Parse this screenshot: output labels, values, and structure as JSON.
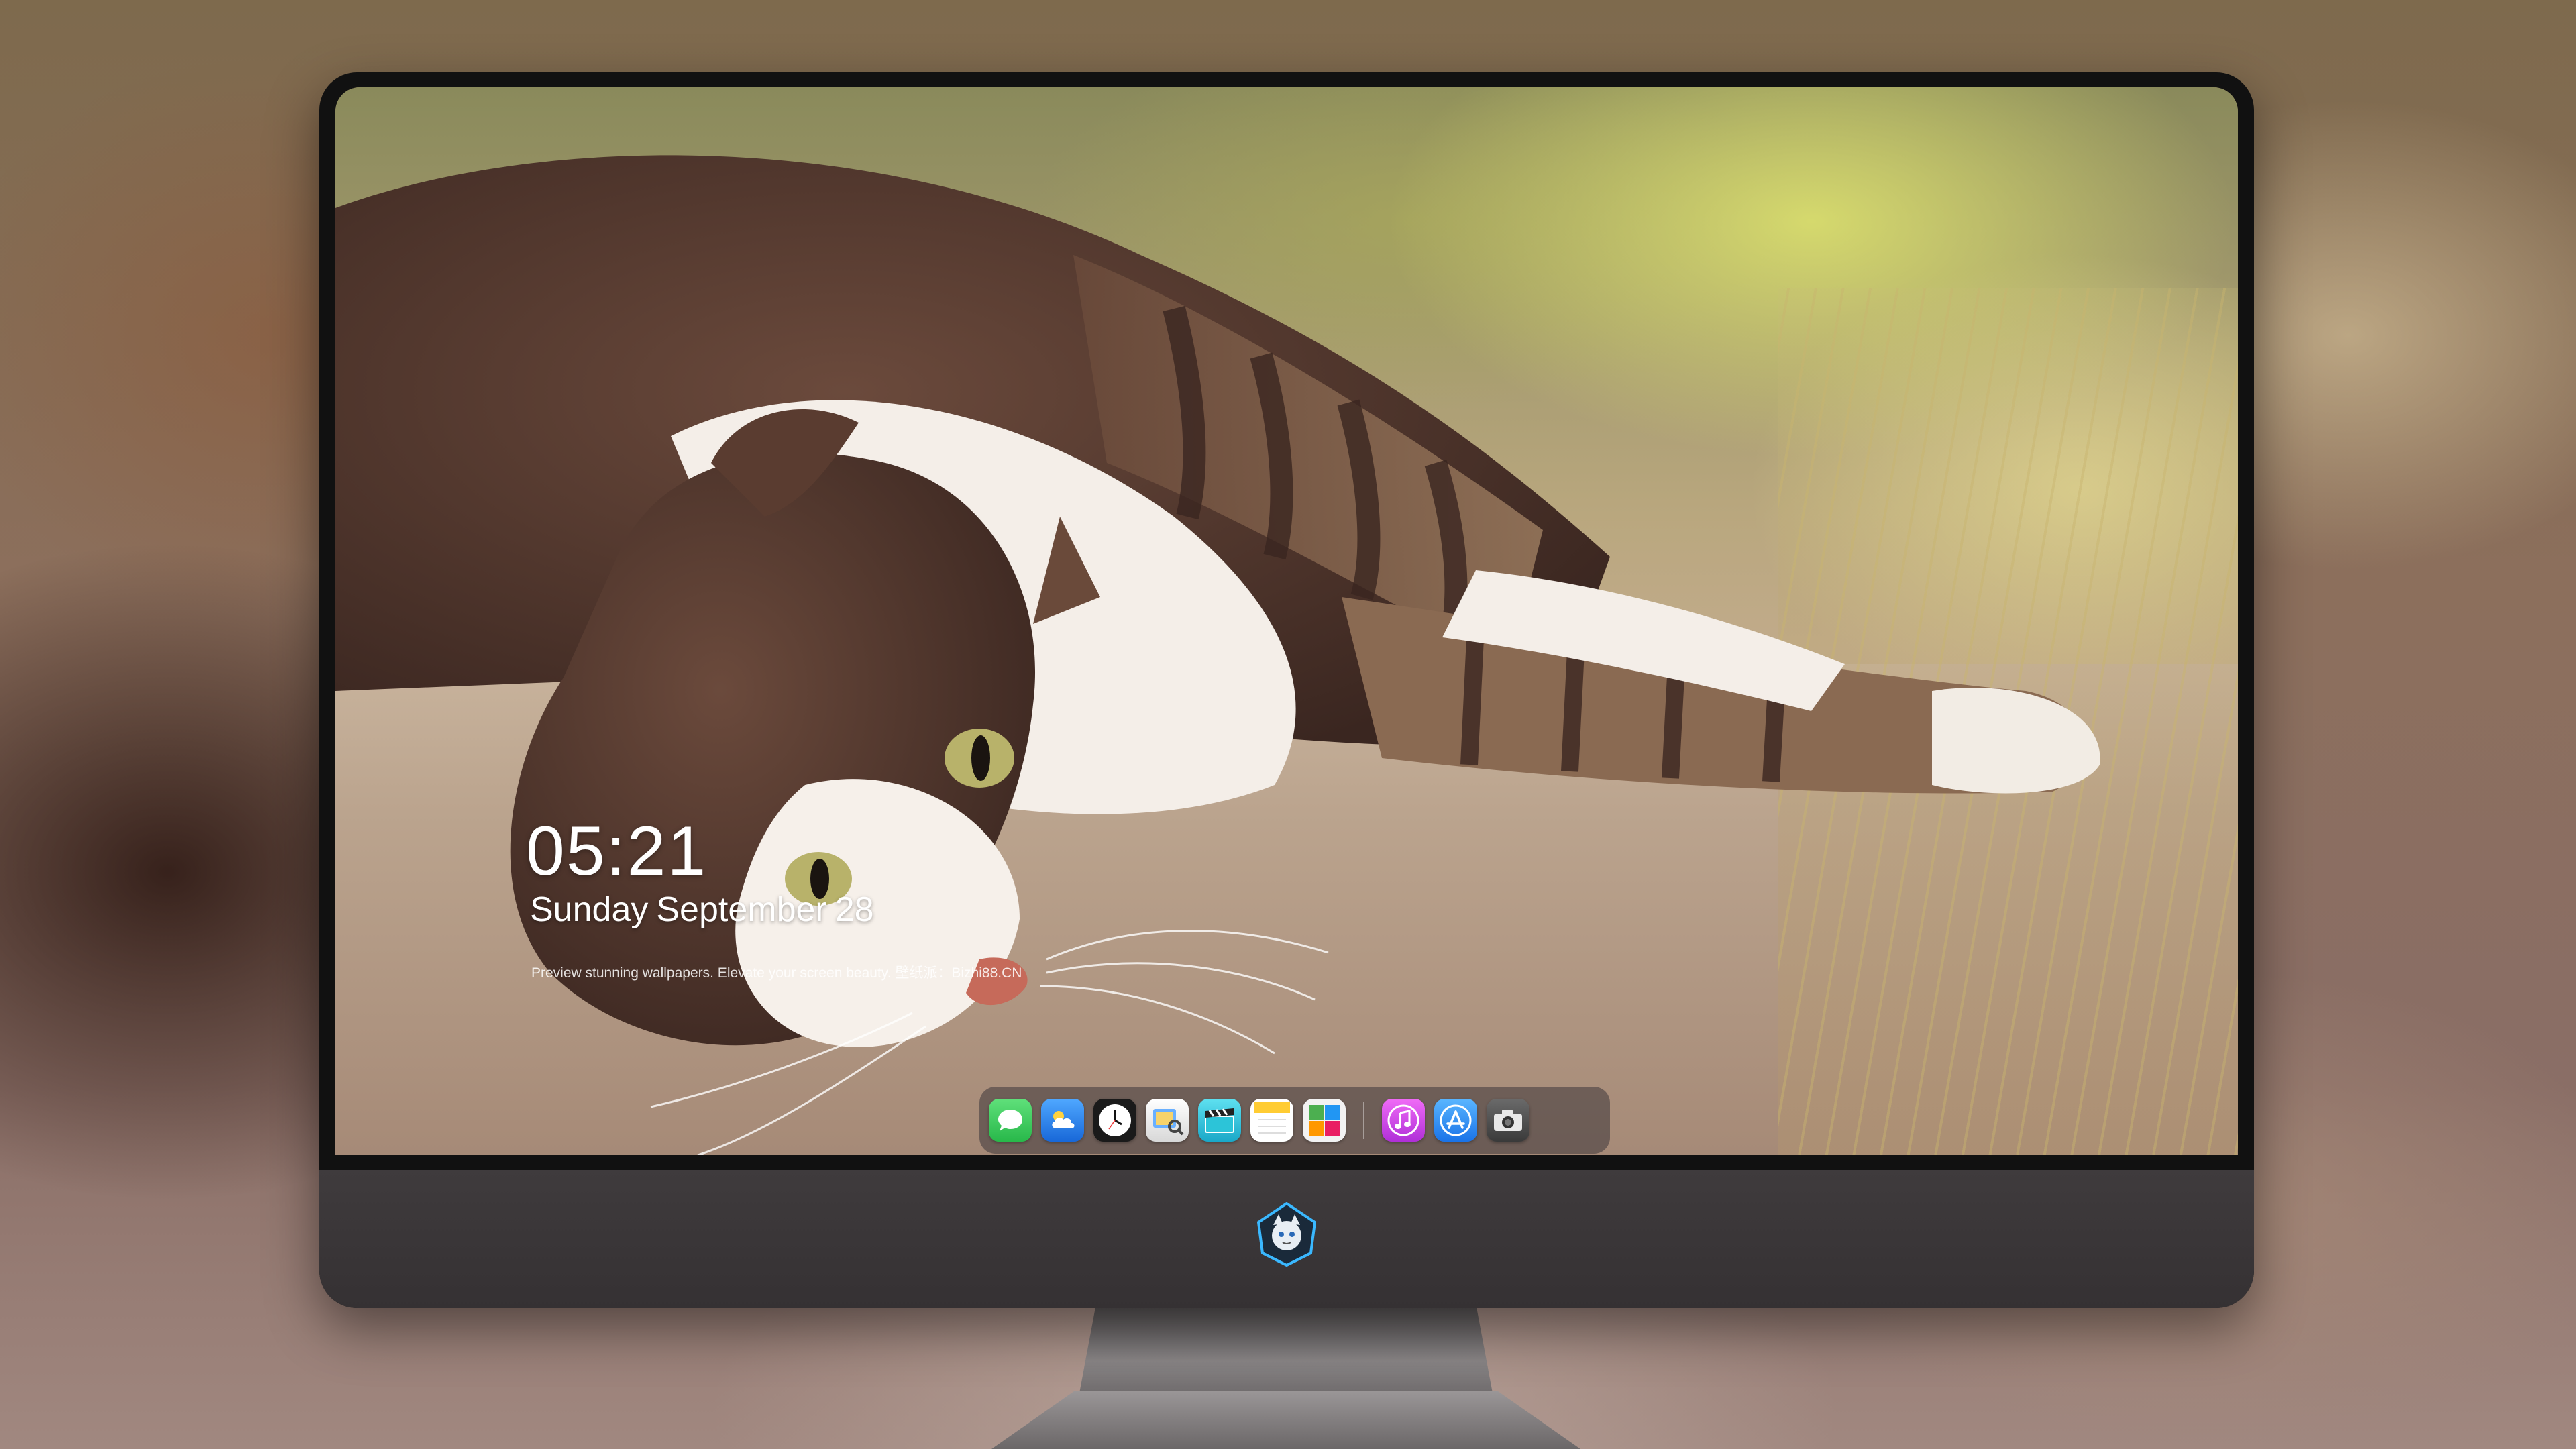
{
  "lock_screen": {
    "time": "05:21",
    "weekday": "Sunday",
    "month": "September",
    "day": "28",
    "tagline": "Preview stunning wallpapers. Elevate your screen beauty. 壁纸派：Bizhi88.CN"
  },
  "dock": {
    "items": [
      {
        "name": "messages-icon",
        "color": "#34c759"
      },
      {
        "name": "weather-icon",
        "color": "#1e88e5"
      },
      {
        "name": "clock-icon",
        "color": "#1a1a1a"
      },
      {
        "name": "preview-icon",
        "color": "#f0c040"
      },
      {
        "name": "clapper-icon",
        "color": "#2cc4d8"
      },
      {
        "name": "notes-icon",
        "color": "#ffd24a"
      },
      {
        "name": "photo-booth-icon",
        "color": "#e8e8e8"
      },
      {
        "name": "music-icon",
        "color": "#d946ef"
      },
      {
        "name": "app-store-icon",
        "color": "#2196f3"
      },
      {
        "name": "camera-icon",
        "color": "#4a4a4a"
      }
    ]
  },
  "colors": {
    "monitor_bezel": "#111111",
    "monitor_chin": "#3f3b3d",
    "text": "#ffffff"
  }
}
